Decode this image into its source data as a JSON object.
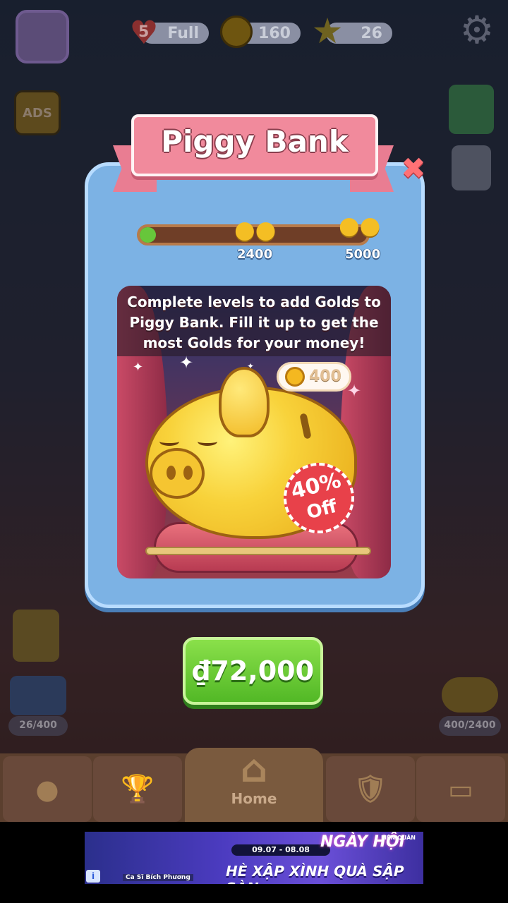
{
  "hud": {
    "lives_count": "5",
    "lives_status": "Full",
    "coins": "160",
    "stars": "26"
  },
  "left_side": {
    "ads_label": "ADS",
    "progress_left": "26/400"
  },
  "right_side": {
    "progress_right": "400/2400"
  },
  "dialog": {
    "title": "Piggy Bank",
    "close_symbol": "✖",
    "milestone_1": "2400",
    "milestone_2": "5000",
    "progress_fraction": 0.07,
    "description": "Complete levels to add Golds to Piggy Bank. Fill it up to get the most Golds for your money!",
    "current_gold": "400",
    "discount_percent": "40%",
    "discount_off": "Off",
    "price": "₫72,000"
  },
  "nav": {
    "home_label": "Home"
  },
  "ad": {
    "date": "09.07 - 08.08",
    "title": "NGÀY HỘI",
    "subtitle": "HÈ XẬP XÌNH QUÀ SẬP SÀN",
    "name": "Ca Sĩ Bích Phương",
    "logo": "LIÊN QUÂN",
    "info": "i"
  },
  "colors": {
    "accent_pink": "#f18a9c",
    "card_blue": "#7cb2e4",
    "buy_green": "#52b826",
    "badge_red": "#e8414a"
  }
}
